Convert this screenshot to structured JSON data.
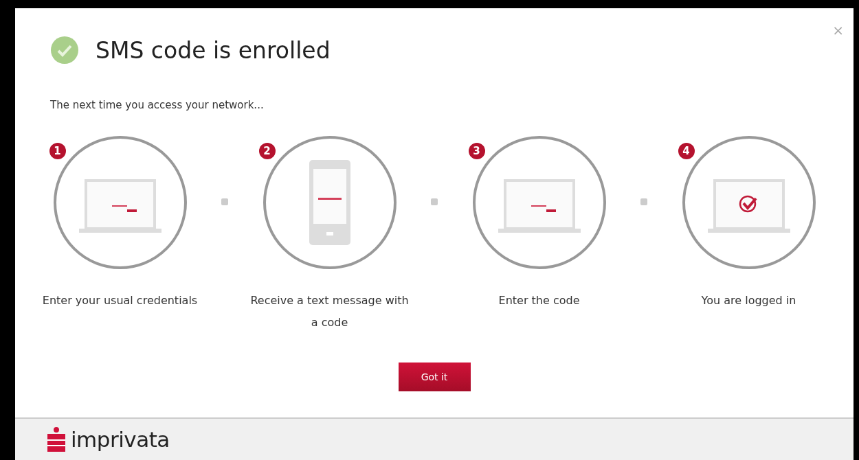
{
  "dialog": {
    "title": "SMS code is enrolled",
    "close": "×",
    "intro": "The next time you access your network...",
    "steps": [
      {
        "number": "1",
        "kind": "laptop-entry",
        "label": "Enter your usual credentials"
      },
      {
        "number": "2",
        "kind": "phone",
        "label": "Receive a text message with a code"
      },
      {
        "number": "3",
        "kind": "laptop-entry",
        "label": "Enter the code"
      },
      {
        "number": "4",
        "kind": "laptop-check",
        "label": "You are logged in"
      }
    ],
    "button": "Got it"
  },
  "footer": {
    "brand": "imprivata"
  }
}
